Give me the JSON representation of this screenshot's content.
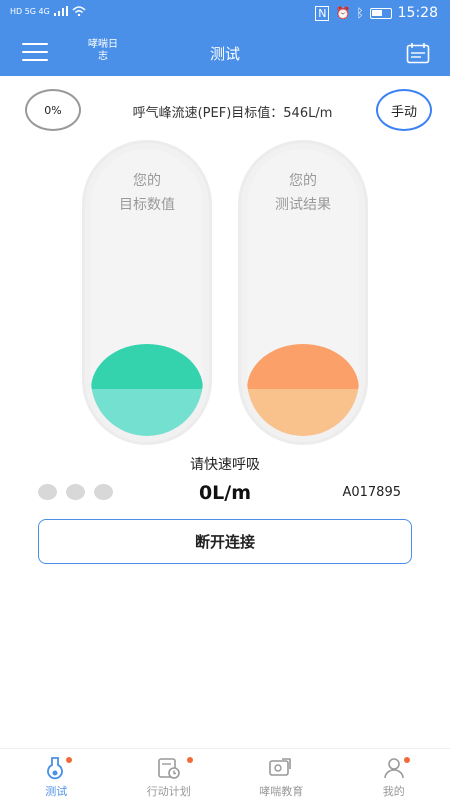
{
  "status": {
    "network_left": "HD 5G 4G",
    "time": "15:28"
  },
  "header": {
    "diary_label": "哮喘日志",
    "title": "测试"
  },
  "measure": {
    "percent": "0%",
    "pef_label": "呼气峰流速(PEF)目标值：546L/m",
    "manual_label": "手动",
    "tube_target_label_line1": "您的",
    "tube_target_label_line2": "目标数值",
    "tube_result_label_line1": "您的",
    "tube_result_label_line2": "测试结果",
    "hint": "请快速呼吸",
    "flow_value": "0L/m",
    "device_id": "A017895",
    "disconnect_label": "断开连接"
  },
  "colors": {
    "accent": "#4a90e8",
    "target_top": "#35d3ad",
    "target_bottom": "#74e0cf",
    "result_top": "#fca06a",
    "result_bottom": "#f9c18c",
    "badge": "#f26a3a"
  },
  "tabs": [
    {
      "label": "测试",
      "icon": "test-icon",
      "active": true,
      "badge": true
    },
    {
      "label": "行动计划",
      "icon": "plan-icon",
      "active": false,
      "badge": true
    },
    {
      "label": "哮喘教育",
      "icon": "education-icon",
      "active": false,
      "badge": false
    },
    {
      "label": "我的",
      "icon": "profile-icon",
      "active": false,
      "badge": true
    }
  ]
}
